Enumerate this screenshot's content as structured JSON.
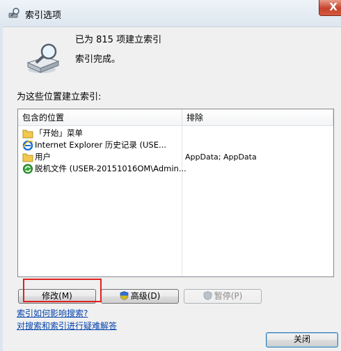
{
  "window": {
    "title": "索引选项",
    "close_label": "X"
  },
  "status": {
    "indexed_count": "已为 815 项建立索引",
    "complete": "索引完成。"
  },
  "section_label": "为这些位置建立索引:",
  "table": {
    "headers": [
      "包含的位置",
      "排除"
    ],
    "rows": [
      {
        "location": "「开始」菜单",
        "exclude": "",
        "icon": "folder-icon"
      },
      {
        "location": "Internet Explorer 历史记录 (USE...",
        "exclude": "",
        "icon": "ie-icon"
      },
      {
        "location": "用户",
        "exclude": "AppData; AppData",
        "icon": "folder-icon"
      },
      {
        "location": "脱机文件 (USER-20151016OM\\Admin...",
        "exclude": "",
        "icon": "sync-center-icon"
      }
    ]
  },
  "buttons": {
    "modify": "修改(M)",
    "advanced": "高级(D)",
    "pause": "暂停(P)",
    "close": "关闭"
  },
  "links": {
    "how_index_affects": "索引如何影响搜索?",
    "troubleshoot": "对搜索和索引进行疑难解答"
  },
  "colors": {
    "link": "#0645ad",
    "highlight": "#e02020",
    "close_red": "#c7422b"
  }
}
